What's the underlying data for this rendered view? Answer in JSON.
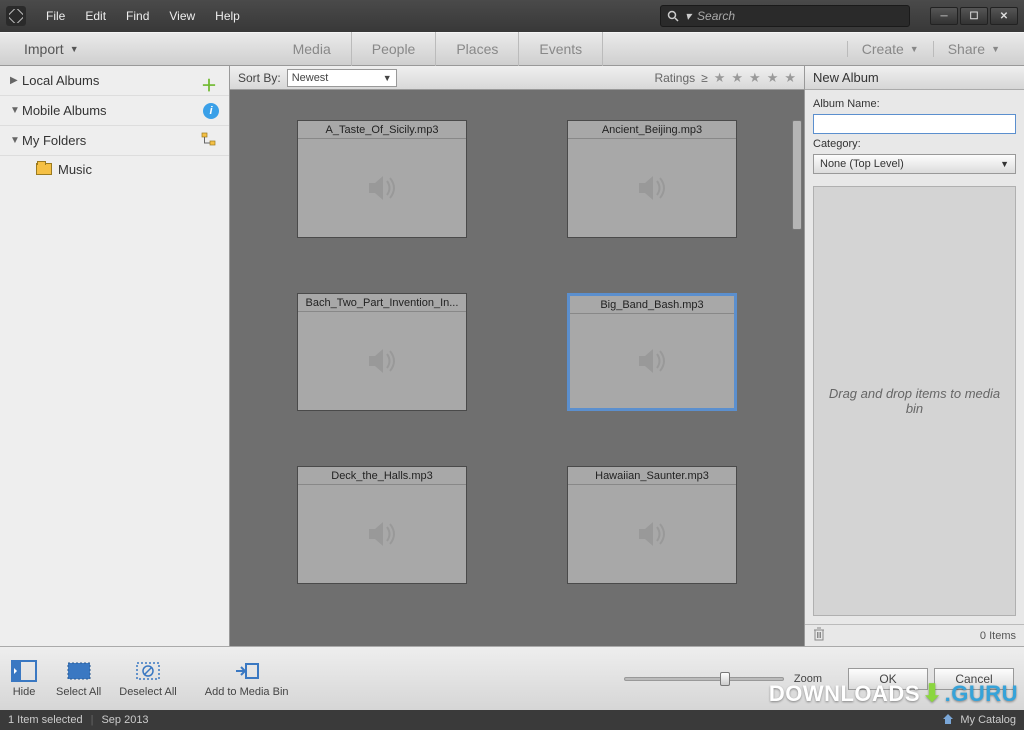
{
  "menubar": [
    "File",
    "Edit",
    "Find",
    "View",
    "Help"
  ],
  "search": {
    "placeholder": "Search"
  },
  "toolbar": {
    "import": "Import",
    "tabs": [
      "Media",
      "People",
      "Places",
      "Events"
    ],
    "create": "Create",
    "share": "Share"
  },
  "sidebar": {
    "local_albums": "Local Albums",
    "mobile_albums": "Mobile Albums",
    "my_folders": "My Folders",
    "music": "Music"
  },
  "sortbar": {
    "sort_by": "Sort By:",
    "sort_value": "Newest",
    "ratings": "Ratings",
    "gte": "≥"
  },
  "thumbs": [
    {
      "name": "A_Taste_Of_Sicily.mp3",
      "selected": false
    },
    {
      "name": "Ancient_Beijing.mp3",
      "selected": false
    },
    {
      "name": "Bach_Two_Part_Invention_In...",
      "selected": false
    },
    {
      "name": "Big_Band_Bash.mp3",
      "selected": true
    },
    {
      "name": "Deck_the_Halls.mp3",
      "selected": false
    },
    {
      "name": "Hawaiian_Saunter.mp3",
      "selected": false
    }
  ],
  "panel": {
    "title": "New Album",
    "album_name_label": "Album Name:",
    "album_name_value": "",
    "category_label": "Category:",
    "category_value": "None (Top Level)",
    "bin_hint": "Drag and drop items to media bin",
    "items_count": "0 Items"
  },
  "bottom": {
    "hide": "Hide",
    "select_all": "Select All",
    "deselect_all": "Deselect All",
    "add_to_bin": "Add to Media Bin",
    "zoom": "Zoom",
    "ok": "OK",
    "cancel": "Cancel"
  },
  "status": {
    "selected": "1 Item selected",
    "date": "Sep 2013",
    "catalog": "My Catalog"
  },
  "watermark": {
    "dl": "DOWNLOADS",
    "guru": ".GURU"
  }
}
